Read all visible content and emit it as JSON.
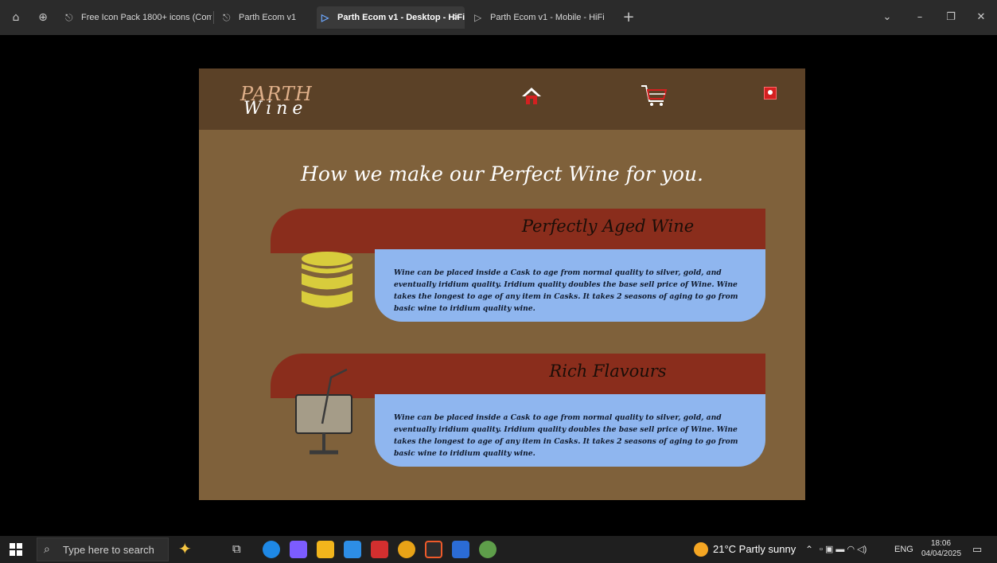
{
  "browser": {
    "tabs": [
      {
        "label": "Free Icon Pack 1800+ icons (Commu",
        "icon": "figma-community-icon"
      },
      {
        "label": "Parth Ecom v1",
        "icon": "figma-community-icon"
      },
      {
        "label": "Parth Ecom v1 - Desktop - HiFi",
        "icon": "play-prototype-icon",
        "active": true
      },
      {
        "label": "Parth Ecom v1 - Mobile - HiFi",
        "icon": "play-prototype-icon"
      }
    ],
    "new_tab": "+",
    "controls": {
      "dropdown": "⌄",
      "minimize": "–",
      "restore": "❐",
      "close": "✕"
    }
  },
  "site": {
    "logo_top": "PARTH",
    "logo_bottom": "Wine",
    "headline": "How we make our Perfect Wine for you.",
    "cards": [
      {
        "title": "Perfectly Aged Wine",
        "text": "Wine can be placed inside a Cask to age from normal quality to silver, gold, and eventually iridium quality. Iridium quality doubles the base sell price of Wine. Wine takes the longest to age of any item in Casks. It takes 2 seasons of aging to go from basic wine to iridium quality wine.",
        "illustration": "stacked-coins-icon"
      },
      {
        "title": "Rich Flavours",
        "text": "Wine can be placed inside a Cask to age from normal quality to silver, gold, and eventually iridium quality. Iridium quality doubles the base sell price of Wine. Wine takes the longest to age of any item in Casks. It takes 2 seasons of aging to go from basic wine to iridium quality wine.",
        "illustration": "wine-glass-straw-icon"
      }
    ],
    "colors": {
      "frame_bg": "#7f613b",
      "navbar_bg": "#5b4127",
      "band": "#8a2d1c",
      "card_body": "#8fb6ef",
      "accent_red": "#d42020"
    }
  },
  "taskbar": {
    "search_placeholder": "Type here to search",
    "weather": "21°C  Partly sunny",
    "language": "ENG",
    "time": "18:06",
    "date": "04/04/2025"
  }
}
